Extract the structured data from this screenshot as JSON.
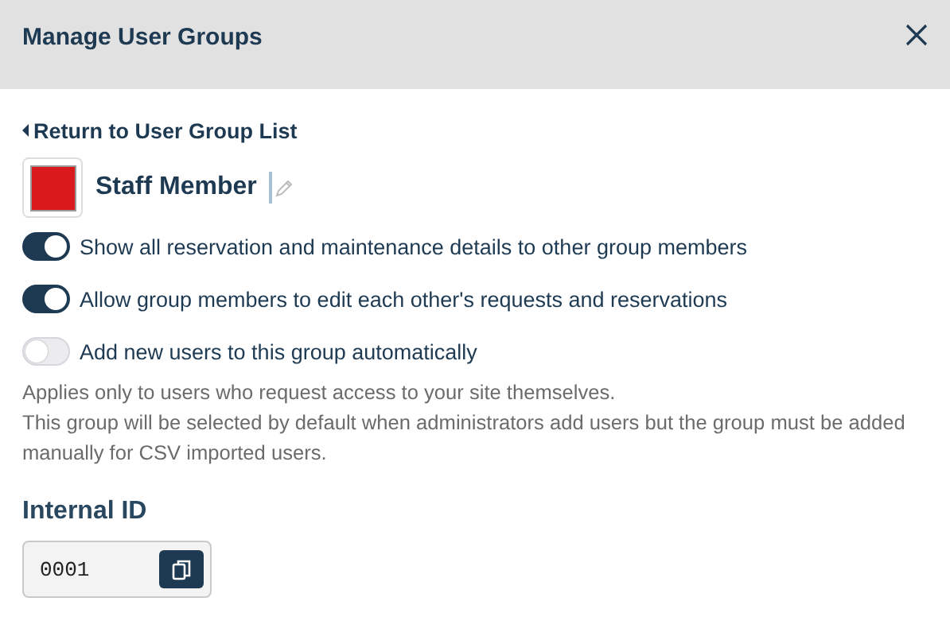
{
  "dialog": {
    "title": "Manage User Groups"
  },
  "back_link": {
    "label": "Return to User Group List"
  },
  "group": {
    "name": "Staff Member",
    "color": "#d9191b"
  },
  "toggles": [
    {
      "label": "Show all reservation and maintenance details to other group members",
      "on": true
    },
    {
      "label": "Allow group members to edit each other's requests and reservations",
      "on": true
    },
    {
      "label": "Add new users to this group automatically",
      "on": false
    }
  ],
  "help_text": [
    "Applies only to users who request access to your site themselves.",
    "This group will be selected by default when administrators add users but the group must be added manually for CSV imported users."
  ],
  "internal_id": {
    "label": "Internal ID",
    "value": "0001"
  }
}
